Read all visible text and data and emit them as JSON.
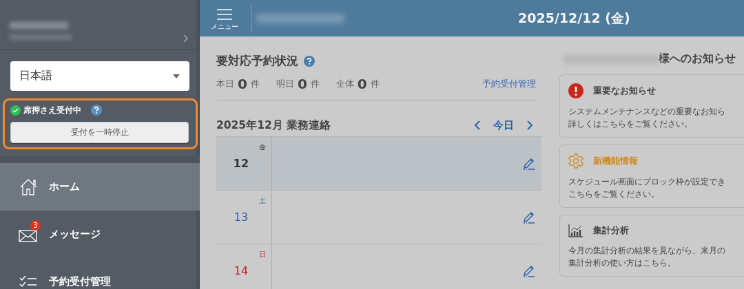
{
  "sidebar": {
    "language_select": {
      "value": "日本語"
    },
    "reservation_status": {
      "on": true,
      "label": "席押さえ受付中",
      "button": "受付を一時停止"
    },
    "nav_items": [
      {
        "label": "ホーム",
        "selected": true
      },
      {
        "label": "メッセージ",
        "badge": "3",
        "selected": false
      },
      {
        "label": "予約受付管理",
        "selected": false
      }
    ]
  },
  "header": {
    "menu_label": "メニュー",
    "date": "2025/12/12 (金)"
  },
  "pending": {
    "title": "要対応予約状況",
    "counts": [
      {
        "label": "本日",
        "value": "0",
        "unit": "件"
      },
      {
        "label": "明日",
        "value": "0",
        "unit": "件"
      },
      {
        "label": "全体",
        "value": "0",
        "unit": "件"
      }
    ],
    "link": "予約受付管理"
  },
  "calendar": {
    "title": "2025年12月 業務連絡",
    "today": "今日",
    "days": [
      {
        "day": "12",
        "weekday": "金",
        "kind": "weekday",
        "selected": true
      },
      {
        "day": "13",
        "weekday": "土",
        "kind": "saturday",
        "selected": false
      },
      {
        "day": "14",
        "weekday": "日",
        "kind": "sunday",
        "selected": false
      }
    ]
  },
  "notices": {
    "title_suffix": "様へのお知らせ",
    "cards": [
      {
        "kind": "important",
        "title": "重要なお知らせ",
        "lines": [
          "システムメンテナンスなどの重要なお知ら",
          "詳しくはこちらをご覧ください。"
        ]
      },
      {
        "kind": "feature",
        "title": "新機能情報",
        "lines": [
          "スケジュール画面にブロック枠が設定でき",
          "こちらをご覧ください。"
        ]
      },
      {
        "kind": "analytics",
        "title": "集計分析",
        "lines": [
          "今月の集計分析の結果を見ながら、来月の",
          "集計分析の使い方はこちら。"
        ]
      }
    ]
  }
}
